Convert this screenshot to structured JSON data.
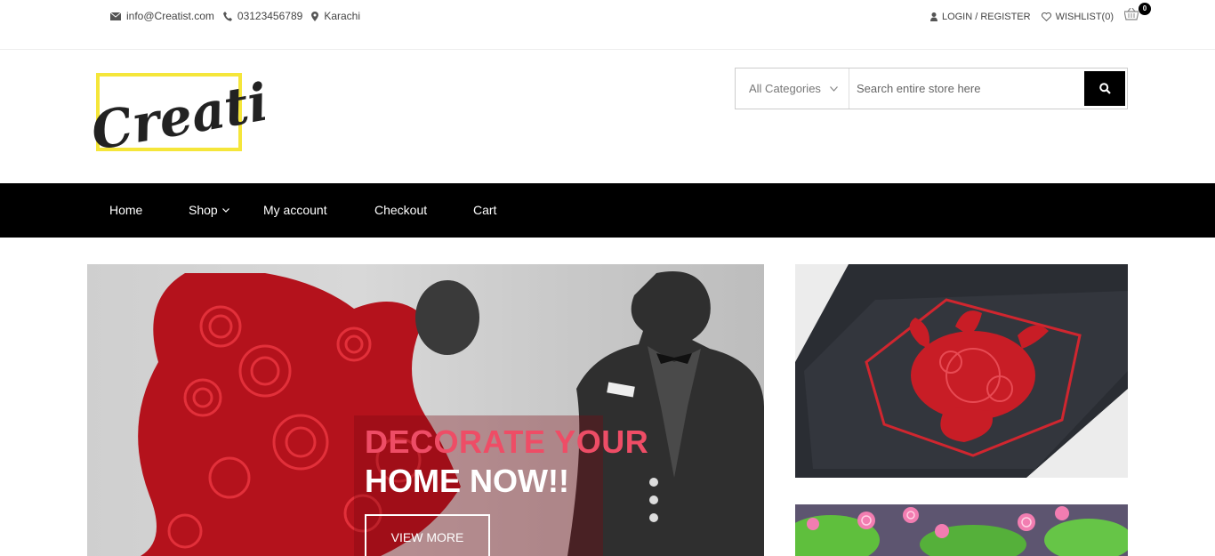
{
  "topbar": {
    "email": "info@Creatist.com",
    "phone": "03123456789",
    "location": "Karachi",
    "login_label": "LOGIN / REGISTER",
    "wishlist_label": "WISHLIST(0)",
    "cart_count": "0"
  },
  "header": {
    "logo_text": "Creatist",
    "search": {
      "category_label": "All Categories",
      "placeholder": "Search entire store here"
    }
  },
  "nav": {
    "items": [
      {
        "label": "Home"
      },
      {
        "label": "Shop"
      },
      {
        "label": "My account"
      },
      {
        "label": "Checkout"
      },
      {
        "label": "Cart"
      }
    ]
  },
  "hero": {
    "line1": "DECORATE YOUR",
    "line2": "HOME NOW!!",
    "button_label": "VIEW MORE"
  },
  "colors": {
    "nav_bg": "#000000",
    "hero_accent": "#ee4d66",
    "logo_frame": "#f5e63a"
  }
}
